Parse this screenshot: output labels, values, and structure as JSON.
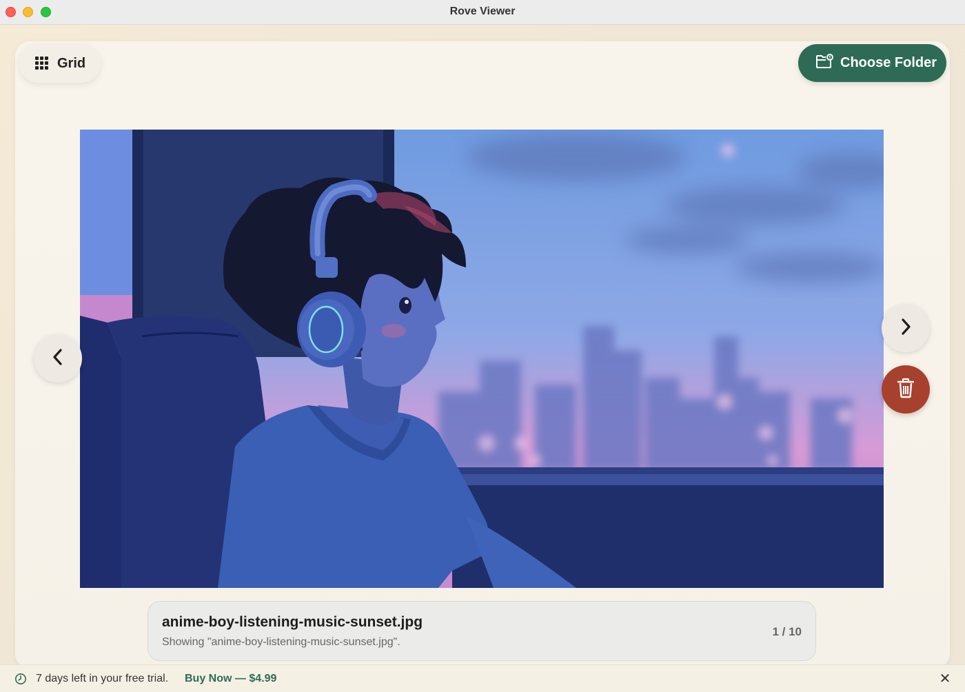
{
  "window": {
    "title": "Rove Viewer"
  },
  "toolbar": {
    "grid_label": "Grid",
    "choose_folder_label": "Choose Folder"
  },
  "viewer": {
    "filename": "anime-boy-listening-music-sunset.jpg",
    "status": "Showing \"anime-boy-listening-music-sunset.jpg\".",
    "counter": "1 / 10",
    "accent_color": "#2e6b57",
    "delete_color": "#a8402e"
  },
  "trial": {
    "message": "7 days left in your free trial.",
    "buy_label": "Buy Now — $4.99",
    "dismiss_label": "✕"
  },
  "icons": [
    "grid-icon",
    "folder-badge-icon",
    "chevron-left-icon",
    "chevron-right-icon",
    "trash-icon",
    "clock-icon",
    "close-icon"
  ]
}
